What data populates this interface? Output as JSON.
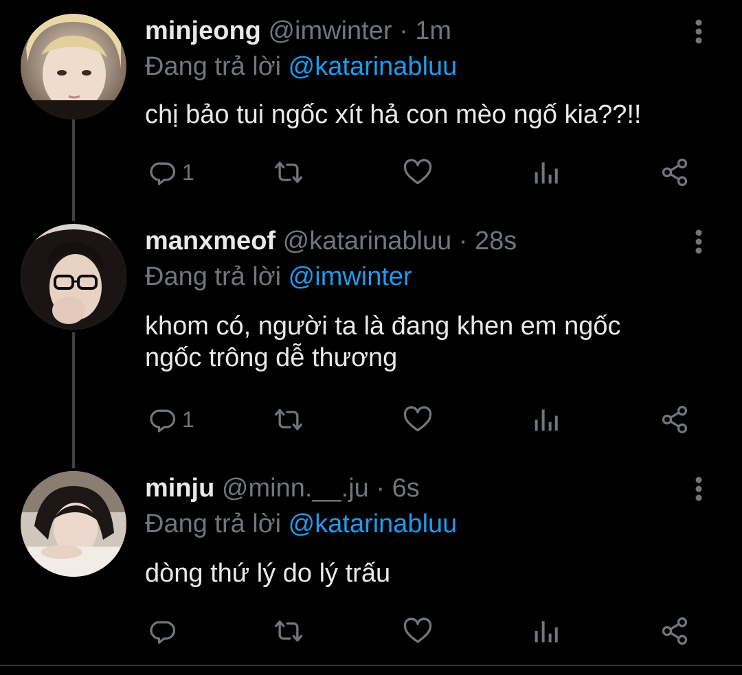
{
  "colors": {
    "background": "#000000",
    "text": "#e7e9ea",
    "muted": "#71767b",
    "accent": "#1d9bf0"
  },
  "tweets": [
    {
      "display_name": "minjeong",
      "handle": "@imwinter",
      "separator": "·",
      "time": "1m",
      "replying_label": "Đang trả lời",
      "replying_to": "@katarinabluu",
      "body_lines": [
        "chị bảo tui ngốc xít hả con mèo ngố kia??!!"
      ],
      "reply_count": "1",
      "icons": [
        "reply-icon",
        "retweet-icon",
        "like-icon",
        "views-icon",
        "share-icon",
        "more-icon"
      ]
    },
    {
      "display_name": "manxmeof",
      "handle": "@katarinabluu",
      "separator": "·",
      "time": "28s",
      "replying_label": "Đang trả lời",
      "replying_to": "@imwinter",
      "body_lines": [
        "khom có, người ta là đang khen em ngốc",
        "ngốc trông dễ thương"
      ],
      "reply_count": "1",
      "icons": [
        "reply-icon",
        "retweet-icon",
        "like-icon",
        "views-icon",
        "share-icon",
        "more-icon"
      ]
    },
    {
      "display_name": "minju",
      "handle": "@minn.__.ju",
      "separator": "·",
      "time": "6s",
      "replying_label": "Đang trả lời",
      "replying_to": "@katarinabluu",
      "body_lines": [
        "dòng thứ lý do lý trấu"
      ],
      "reply_count": "",
      "icons": [
        "reply-icon",
        "retweet-icon",
        "like-icon",
        "views-icon",
        "share-icon",
        "more-icon"
      ]
    }
  ]
}
